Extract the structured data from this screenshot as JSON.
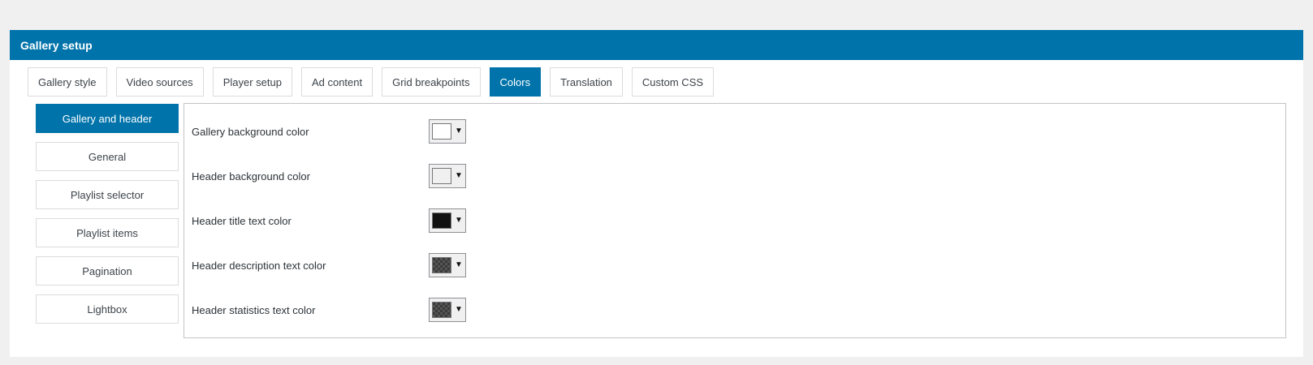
{
  "panel": {
    "title": "Gallery setup",
    "accent_color": "#0073aa"
  },
  "tabs": [
    {
      "label": "Gallery style",
      "active": false
    },
    {
      "label": "Video sources",
      "active": false
    },
    {
      "label": "Player setup",
      "active": false
    },
    {
      "label": "Ad content",
      "active": false
    },
    {
      "label": "Grid breakpoints",
      "active": false
    },
    {
      "label": "Colors",
      "active": true
    },
    {
      "label": "Translation",
      "active": false
    },
    {
      "label": "Custom CSS",
      "active": false
    }
  ],
  "subnav": [
    {
      "label": "Gallery and header",
      "active": true
    },
    {
      "label": "General",
      "active": false
    },
    {
      "label": "Playlist selector",
      "active": false
    },
    {
      "label": "Playlist items",
      "active": false
    },
    {
      "label": "Pagination",
      "active": false
    },
    {
      "label": "Lightbox",
      "active": false
    }
  ],
  "color_settings": [
    {
      "label": "Gallery background color",
      "color": "#ffffff",
      "pattern": "solid",
      "icon": "caret-down-icon"
    },
    {
      "label": "Header background color",
      "color": "#f0f0f1",
      "pattern": "solid",
      "icon": "caret-down-icon"
    },
    {
      "label": "Header title text color",
      "color": "#111111",
      "pattern": "solid",
      "icon": "caret-down-icon"
    },
    {
      "label": "Header description text color",
      "color": "#444444",
      "pattern": "checker",
      "icon": "caret-down-icon"
    },
    {
      "label": "Header statistics text color",
      "color": "#444444",
      "pattern": "checker",
      "icon": "caret-down-icon"
    }
  ]
}
